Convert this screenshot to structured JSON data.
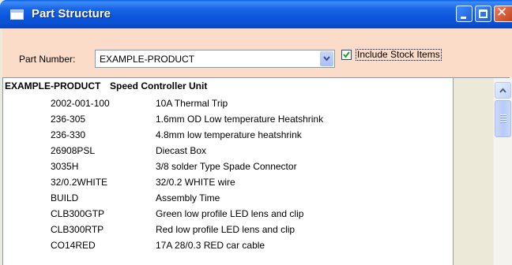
{
  "window": {
    "title": "Part Structure"
  },
  "icons": {
    "app": "app-window-icon",
    "minimize": "minimize-icon",
    "maximize": "maximize-icon",
    "close": "close-icon",
    "dropdown": "chevron-down-icon",
    "check": "checkmark-icon",
    "scroll_up": "scroll-up-arrow-icon"
  },
  "toolbar": {
    "part_number_label": "Part Number:",
    "part_number_value": "EXAMPLE-PRODUCT",
    "include_stock_label": "Include Stock Items",
    "include_stock_checked": true
  },
  "list": {
    "header": {
      "code": "EXAMPLE-PRODUCT",
      "desc": "Speed Controller Unit"
    },
    "rows": [
      {
        "code": "2002-001-100",
        "desc": "10A Thermal Trip"
      },
      {
        "code": "236-305",
        "desc": "1.6mm OD Low temperature Heatshrink"
      },
      {
        "code": "236-330",
        "desc": "4.8mm low temperature heatshrink"
      },
      {
        "code": "26908PSL",
        "desc": "Diecast Box"
      },
      {
        "code": "3035H",
        "desc": "3/8 solder Type Spade Connector"
      },
      {
        "code": "32/0.2WHITE",
        "desc": "32/0.2 WHITE wire"
      },
      {
        "code": "BUILD",
        "desc": "Assembly Time"
      },
      {
        "code": "CLB300GTP",
        "desc": "Green low profile LED lens and clip"
      },
      {
        "code": "CLB300RTP",
        "desc": "Red low profile LED lens and clip"
      },
      {
        "code": "CO14RED",
        "desc": "17A 28/0.3 RED car cable"
      }
    ]
  },
  "colors": {
    "title_bar": "#0a56dc",
    "toolbar_bg": "#fbdcc8",
    "close_button": "#d4542c"
  }
}
